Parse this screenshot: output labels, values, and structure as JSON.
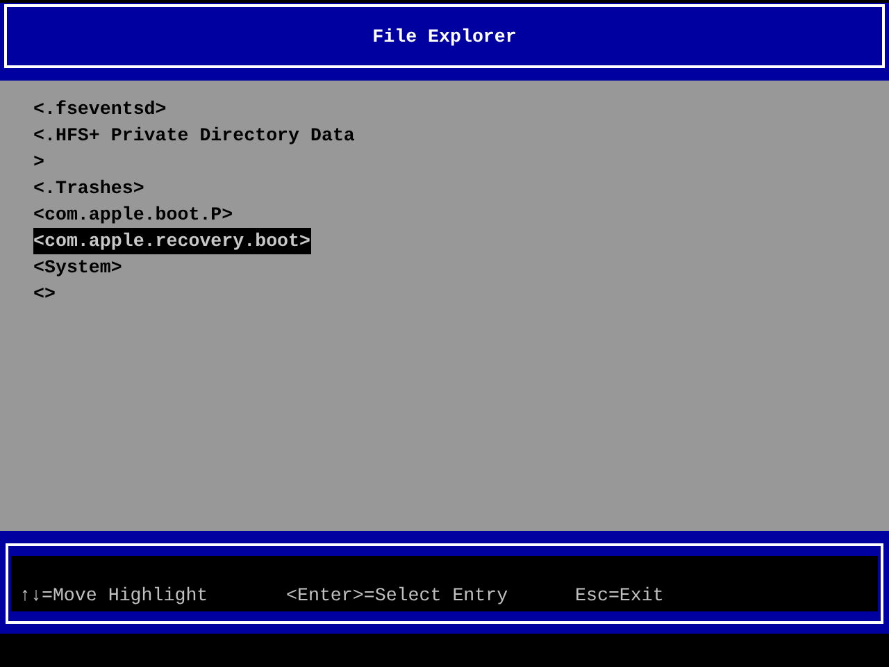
{
  "window": {
    "title": "File Explorer"
  },
  "entries": [
    {
      "label": "<.fseventsd>",
      "selected": false
    },
    {
      "label": "<.HFS+ Private Directory Data",
      "selected": false
    },
    {
      "label": ">",
      "selected": false
    },
    {
      "label": "<.Trashes>",
      "selected": false
    },
    {
      "label": "<com.apple.boot.P>",
      "selected": false
    },
    {
      "label": "<com.apple.recovery.boot>",
      "selected": true
    },
    {
      "label": "<System>",
      "selected": false
    },
    {
      "label": "<>",
      "selected": false
    }
  ],
  "hints": [
    "↑↓=Move Highlight",
    "<Enter>=Select Entry",
    "Esc=Exit"
  ]
}
